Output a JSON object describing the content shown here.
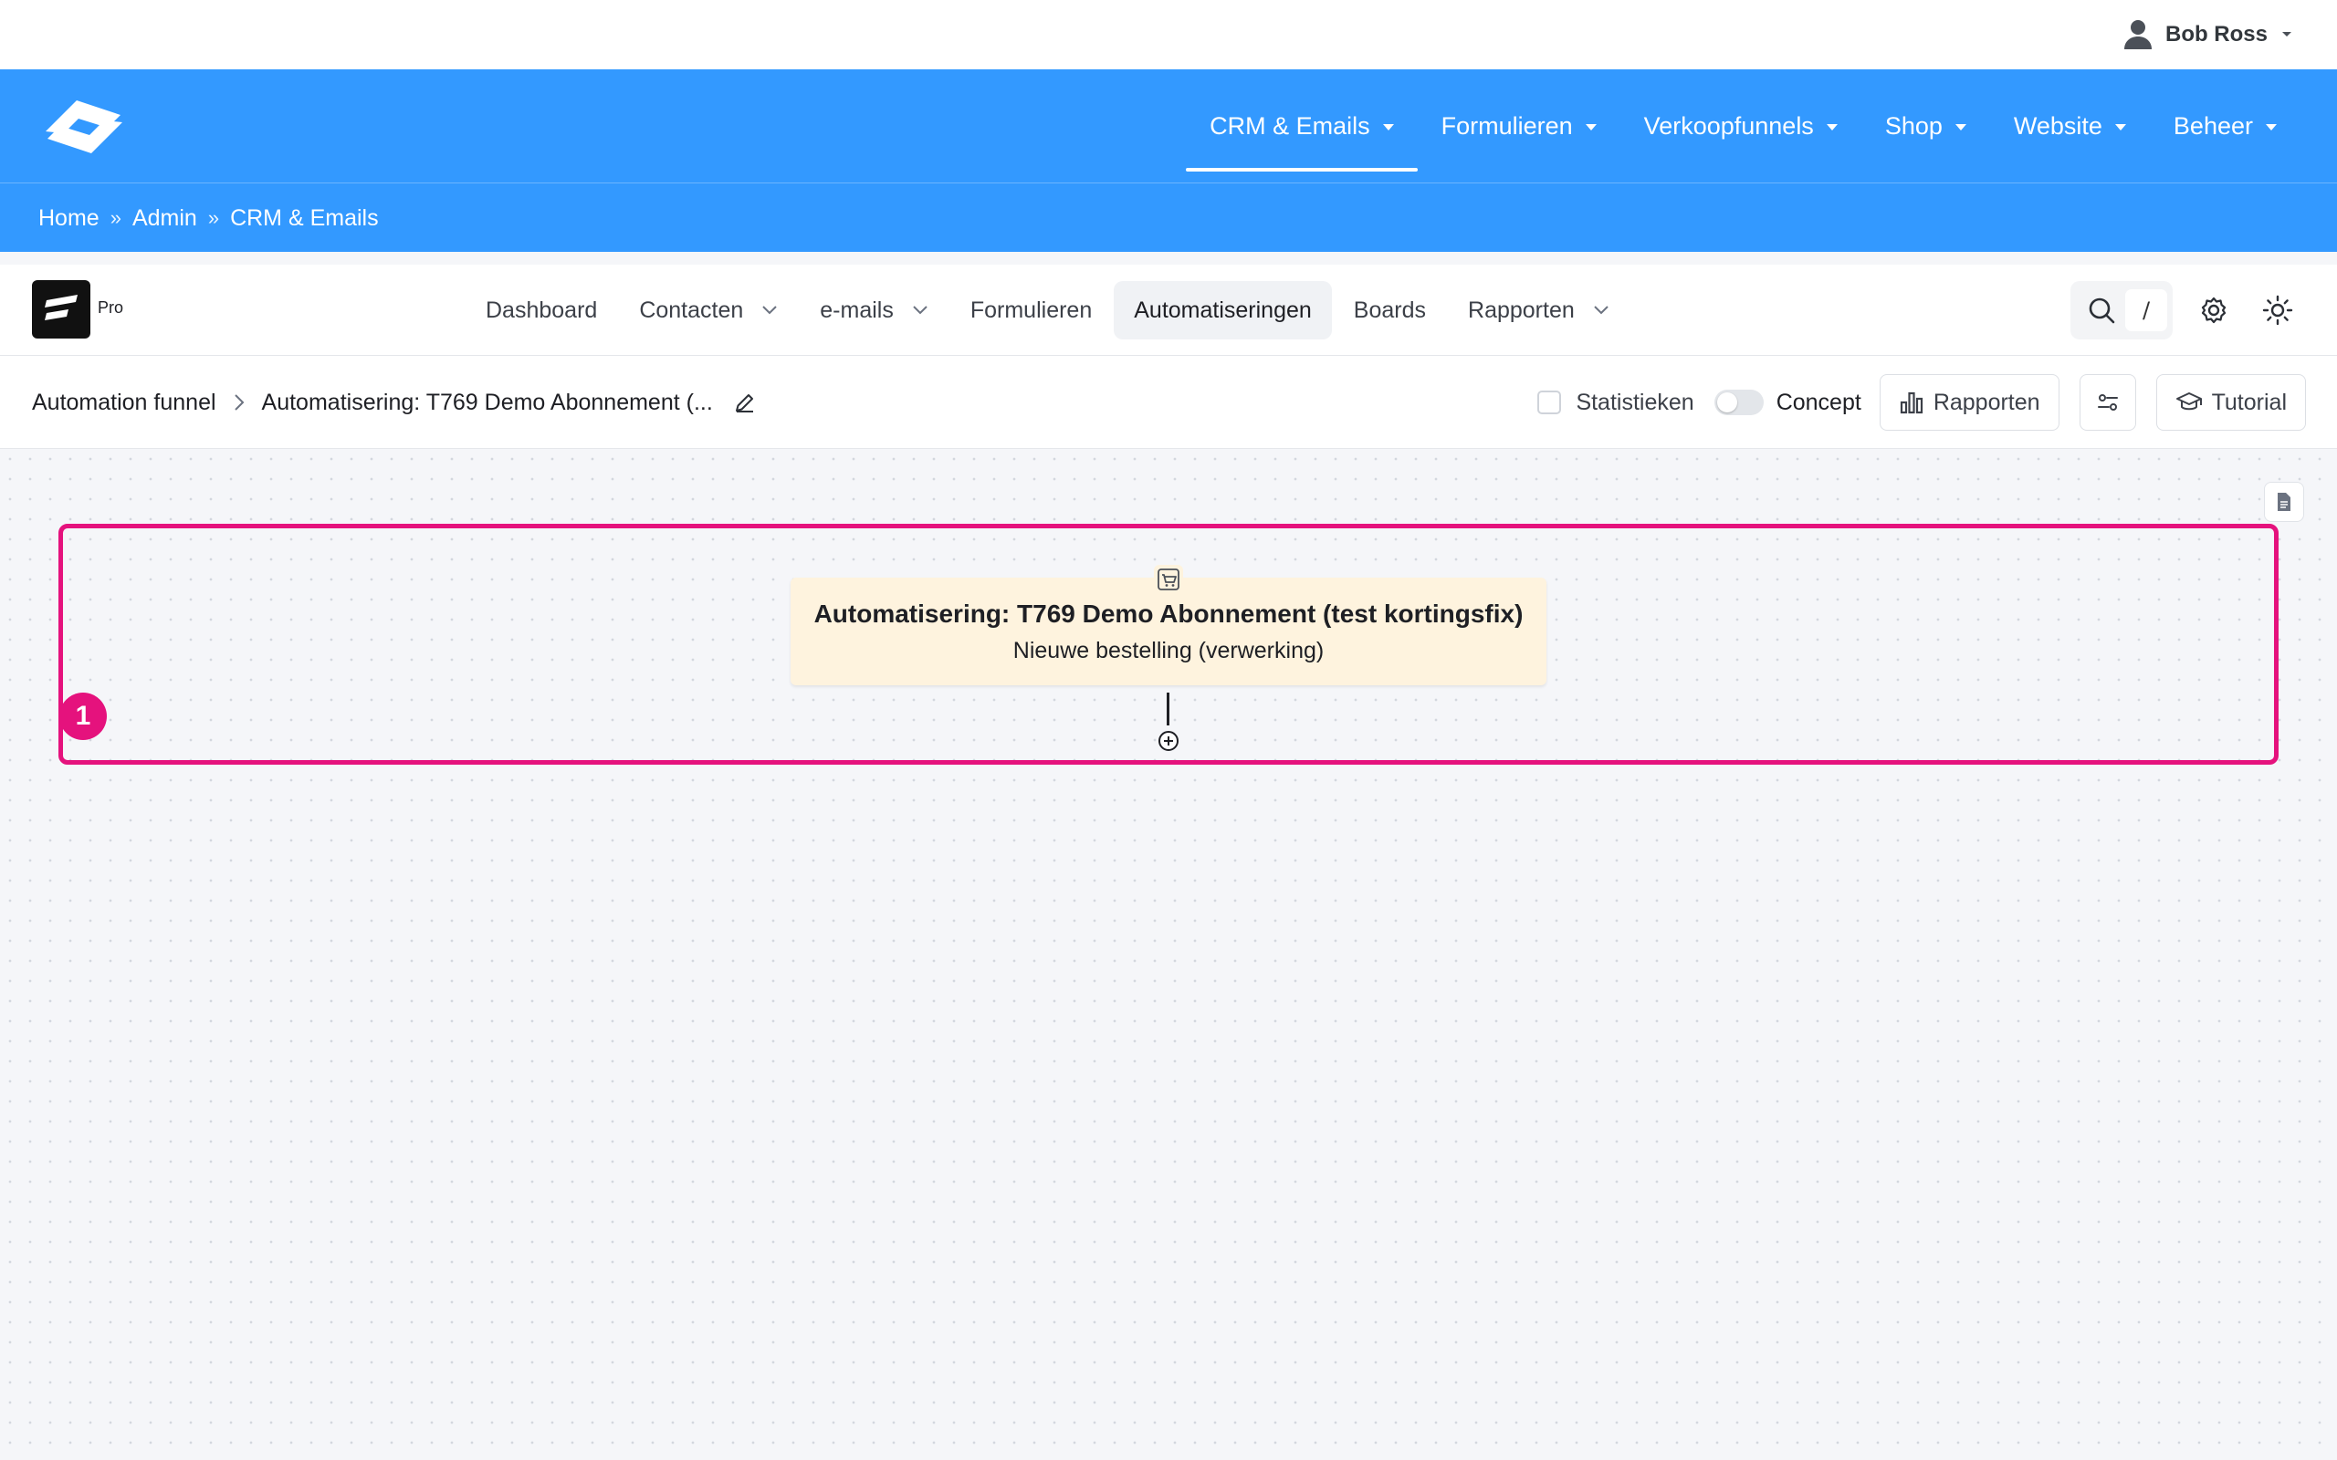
{
  "user": {
    "name": "Bob Ross",
    "icon": "user-icon"
  },
  "main_nav": [
    {
      "label": "CRM & Emails",
      "active": true
    },
    {
      "label": "Formulieren",
      "active": false
    },
    {
      "label": "Verkoopfunnels",
      "active": false
    },
    {
      "label": "Shop",
      "active": false
    },
    {
      "label": "Website",
      "active": false
    },
    {
      "label": "Beheer",
      "active": false
    }
  ],
  "breadcrumbs": {
    "home": "Home",
    "admin": "Admin",
    "current": "CRM & Emails",
    "separator": "»"
  },
  "app": {
    "brand_suffix": "Pro",
    "menu": [
      {
        "label": "Dashboard"
      },
      {
        "label": "Contacten"
      },
      {
        "label": "e-mails"
      },
      {
        "label": "Formulieren"
      },
      {
        "label": "Automatiseringen"
      },
      {
        "label": "Boards"
      },
      {
        "label": "Rapporten"
      }
    ],
    "search_shortcut": "/"
  },
  "toolbar": {
    "root_label": "Automation funnel",
    "funnel_title": "Automatisering: T769 Demo Abonnement (...",
    "stats_label": "Statistieken",
    "concept_label": "Concept",
    "concept_on": false,
    "reports_button": "Rapporten",
    "tutorial_button": "Tutorial"
  },
  "canvas": {
    "step_number": "1",
    "trigger": {
      "title": "Automatisering: T769 Demo Abonnement (test kortingsfix)",
      "subtitle": "Nieuwe bestelling (verwerking)"
    }
  },
  "colors": {
    "admin_bar": "#3399ff",
    "highlight": "#e5127d",
    "trigger_bg": "#fef3de"
  }
}
